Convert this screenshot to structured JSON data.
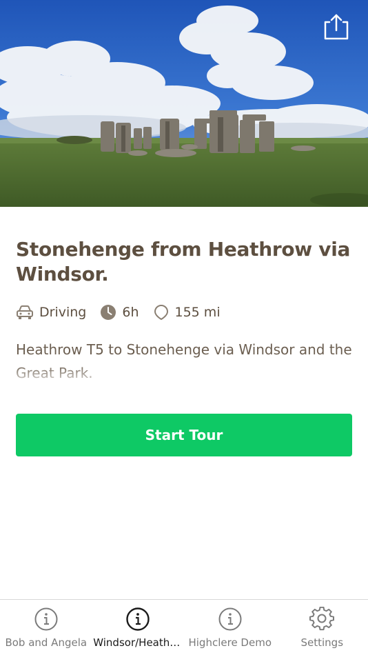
{
  "hero": {
    "image_subject": "Stonehenge under a blue sky with white clouds",
    "share_icon": "share-icon"
  },
  "tour": {
    "title": "Stonehenge from Heathrow via Windsor.",
    "mode_icon": "car-icon",
    "mode": "Driving",
    "duration_icon": "clock-icon",
    "duration": "6h",
    "distance_icon": "map-pin-icon",
    "distance": "155 mi",
    "description": "Heathrow T5 to Stonehenge via Windsor and the Great Park.",
    "start_label": "Start Tour"
  },
  "tabs": [
    {
      "label": "Bob and Angela",
      "icon": "info-icon",
      "active": false
    },
    {
      "label": "Windsor/Heathrow",
      "icon": "info-icon",
      "active": true
    },
    {
      "label": "Highclere Demo",
      "icon": "info-icon",
      "active": false
    },
    {
      "label": "Settings",
      "icon": "gear-icon",
      "active": false
    }
  ],
  "colors": {
    "accent": "#0ec965",
    "title_text": "#5d4f40",
    "body_text": "#6b5e50",
    "tab_inactive": "#7a7a7a",
    "tab_active": "#1a1a1a"
  }
}
